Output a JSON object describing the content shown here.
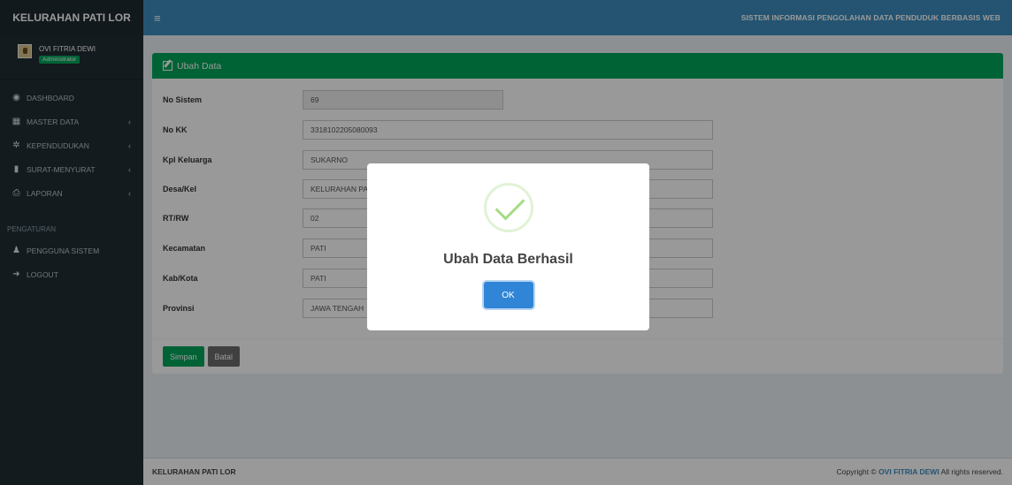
{
  "app": {
    "brand": "KELURAHAN PATI LOR",
    "system_title": "SISTEM INFORMASI PENGOLAHAN DATA PENDUDUK BERBASIS WEB"
  },
  "user": {
    "name": "OVI FITRIA DEWI",
    "role": "Administrator"
  },
  "sidebar": {
    "items": [
      {
        "label": "DASHBOARD",
        "icon": "dashboard-icon",
        "chevron": ""
      },
      {
        "label": "MASTER DATA",
        "icon": "table-icon",
        "chevron": "‹"
      },
      {
        "label": "KEPENDUDUKAN",
        "icon": "cogs-icon",
        "chevron": "‹"
      },
      {
        "label": "SURAT-MENYURAT",
        "icon": "file-icon",
        "chevron": "‹"
      },
      {
        "label": "LAPORAN",
        "icon": "print-icon",
        "chevron": "‹"
      }
    ],
    "section_header": "PENGATURAN",
    "settings_items": [
      {
        "label": "PENGGUNA SISTEM",
        "icon": "user-icon"
      },
      {
        "label": "LOGOUT",
        "icon": "logout-icon"
      }
    ]
  },
  "form": {
    "title": "Ubah Data",
    "fields": [
      {
        "label": "No Sistem",
        "value": "69"
      },
      {
        "label": "No KK",
        "value": "3318102205080093"
      },
      {
        "label": "Kpl Keluarga",
        "value": "SUKARNO"
      },
      {
        "label": "Desa/Kel",
        "value": "KELURAHAN PA"
      },
      {
        "label": "RT/RW",
        "value": "02"
      },
      {
        "label": "Kecamatan",
        "value": "PATI"
      },
      {
        "label": "Kab/Kota",
        "value": "PATI"
      },
      {
        "label": "Provinsi",
        "value": "JAWA TENGAH"
      }
    ],
    "save_label": "Simpan",
    "cancel_label": "Batal"
  },
  "footer": {
    "left": "KELURAHAN PATI LOR",
    "copyright_prefix": "Copyright ©",
    "author": "OVI FITRIA DEWI",
    "suffix": "All rights reserved."
  },
  "modal": {
    "title": "Ubah Data Berhasil",
    "ok_label": "OK"
  },
  "colors": {
    "topbar": "#3c8dbc",
    "sidebar": "#222d32",
    "success": "#00a65a",
    "modal_button": "#3085d6",
    "check": "#a5dc86"
  }
}
